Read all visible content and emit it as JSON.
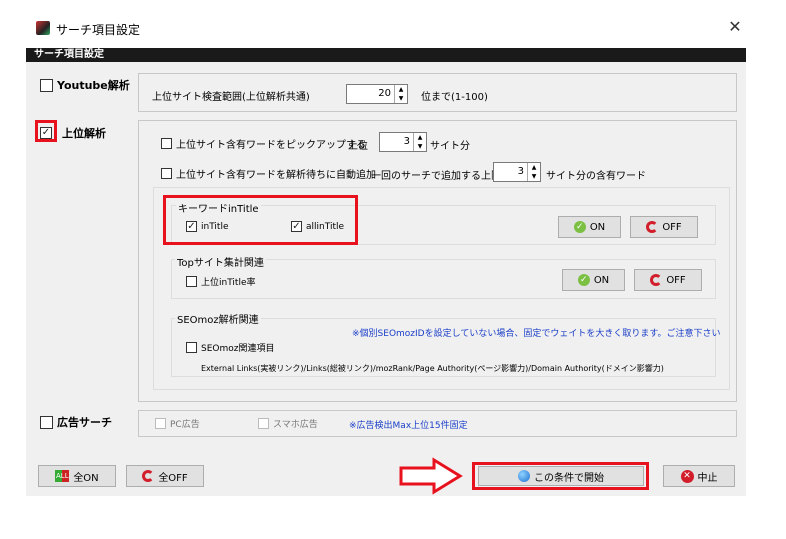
{
  "window": {
    "title": "サーチ項目設定",
    "close_glyph": "✕"
  },
  "header": {
    "label": "サーチ項目設定"
  },
  "youtube": {
    "label": "Youtube解析",
    "checked": false,
    "range_label": "上位サイト検査範囲(上位解析共通)",
    "range_value": "20",
    "range_suffix": "位まで(1-100)"
  },
  "upper": {
    "label": "上位解析",
    "checked": true,
    "pickup_label": "上位サイト含有ワードをピックアップする",
    "pickup_prefix": "上位",
    "pickup_value": "3",
    "pickup_suffix": "サイト分",
    "auto_label": "上位サイト含有ワードを解析待ちに自動追加",
    "auto_mid": "一回のサーチで追加する上限",
    "auto_value": "3",
    "auto_suffix": "サイト分の含有ワード"
  },
  "keyword_group": {
    "title": "キーワードinTitle",
    "intitle": "inTitle",
    "allintitle": "allinTitle",
    "on": "ON",
    "off": "OFF"
  },
  "top_group": {
    "title": "Topサイト集計関連",
    "item": "上位inTitle率",
    "on": "ON",
    "off": "OFF"
  },
  "seo_group": {
    "title": "SEOmoz解析関連",
    "note": "※個別SEOmozIDを設定していない場合、固定でウェイトを大きく取ります。ご注意下さい",
    "item": "SEOmoz関連項目",
    "desc": "External Links(実被リンク)/Links(総被リンク)/mozRank/Page Authority(ページ影響力)/Domain Authority(ドメイン影響力)"
  },
  "ads": {
    "label": "広告サーチ",
    "pc": "PC広告",
    "sp": "スマホ広告",
    "note": "※広告検出Max上位15件固定"
  },
  "footer": {
    "all_on": "全ON",
    "all_off": "全OFF",
    "start": "この条件で開始",
    "cancel": "中止"
  },
  "colors": {
    "highlight": "#e8121e",
    "note_blue": "#1a3ec8"
  }
}
